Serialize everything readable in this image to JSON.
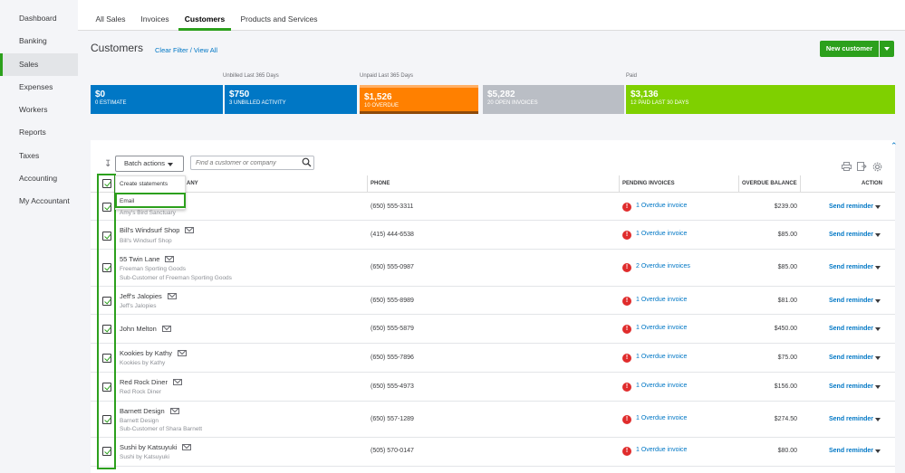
{
  "sidebar": [
    "Dashboard",
    "Banking",
    "Sales",
    "Expenses",
    "Workers",
    "Reports",
    "Taxes",
    "Accounting",
    "My Accountant"
  ],
  "tabs": [
    "All Sales",
    "Invoices",
    "Customers",
    "Products and Services"
  ],
  "header": {
    "title": "Customers",
    "clear_filter": "Clear Filter / View All",
    "new_button": "New customer"
  },
  "money_bar": {
    "labels": {
      "unbilled": "Unbilled Last 365 Days",
      "unpaid": "Unpaid Last 365 Days",
      "paid": "Paid"
    },
    "segments": [
      {
        "amount": "$0",
        "sub": "0 ESTIMATE",
        "color": "#0077c5"
      },
      {
        "amount": "$750",
        "sub": "3 UNBILLED ACTIVITY",
        "color": "#0077c5"
      },
      {
        "amount": "$1,526",
        "sub": "10 OVERDUE",
        "color": "#ff8000"
      },
      {
        "amount": "$5,282",
        "sub": "20 OPEN INVOICES",
        "color": "#babec5"
      },
      {
        "amount": "$3,136",
        "sub": "12 PAID LAST 30 DAYS",
        "color": "#7fd000"
      }
    ]
  },
  "toolbar": {
    "batch_label": "Batch actions",
    "search_placeholder": "Find a customer or company"
  },
  "batch_menu": [
    "Create statements",
    "Email"
  ],
  "columns": {
    "customer_partial": "ANY",
    "phone": "PHONE",
    "pending": "PENDING INVOICES",
    "overdue": "OVERDUE BALANCE",
    "action": "ACTION"
  },
  "rows": [
    {
      "name": "",
      "subs": [
        "Amy's Bird Sanctuary"
      ],
      "phone": "(650) 555-3311",
      "pending": "1 Overdue invoice",
      "balance": "$239.00",
      "action": "Send reminder"
    },
    {
      "name": "Bill's Windsurf Shop",
      "subs": [
        "Bill's Windsurf Shop"
      ],
      "phone": "(415) 444-6538",
      "pending": "1 Overdue invoice",
      "balance": "$85.00",
      "action": "Send reminder"
    },
    {
      "name": "55 Twin Lane",
      "subs": [
        "Freeman Sporting Goods",
        "Sub-Customer of Freeman Sporting Goods"
      ],
      "phone": "(650) 555-0987",
      "pending": "2 Overdue invoices",
      "balance": "$85.00",
      "action": "Send reminder"
    },
    {
      "name": "Jeff's Jalopies",
      "subs": [
        "Jeff's Jalopies"
      ],
      "phone": "(650) 555-8989",
      "pending": "1 Overdue invoice",
      "balance": "$81.00",
      "action": "Send reminder"
    },
    {
      "name": "John Melton",
      "subs": [],
      "phone": "(650) 555-5879",
      "pending": "1 Overdue invoice",
      "balance": "$450.00",
      "action": "Send reminder"
    },
    {
      "name": "Kookies by Kathy",
      "subs": [
        "Kookies by Kathy"
      ],
      "phone": "(650) 555-7896",
      "pending": "1 Overdue invoice",
      "balance": "$75.00",
      "action": "Send reminder"
    },
    {
      "name": "Red Rock Diner",
      "subs": [
        "Red Rock Diner"
      ],
      "phone": "(650) 555-4973",
      "pending": "1 Overdue invoice",
      "balance": "$156.00",
      "action": "Send reminder"
    },
    {
      "name": "Barnett Design",
      "subs": [
        "Barnett Design",
        "Sub-Customer of Shara Barnett"
      ],
      "phone": "(650) 557-1289",
      "pending": "1 Overdue invoice",
      "balance": "$274.50",
      "action": "Send reminder"
    },
    {
      "name": "Sushi by Katsuyuki",
      "subs": [
        "Sushi by Katsuyuki"
      ],
      "phone": "(505) 570-0147",
      "pending": "1 Overdue invoice",
      "balance": "$80.00",
      "action": "Send reminder"
    }
  ]
}
